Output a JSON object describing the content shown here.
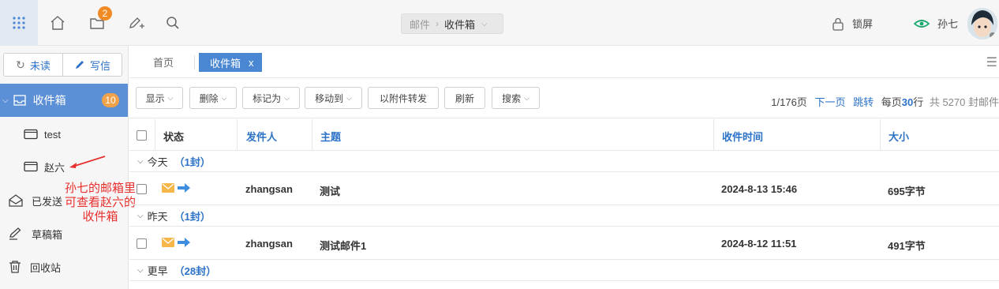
{
  "topbar": {
    "compose_badge": "2",
    "breadcrumb": {
      "root": "邮件",
      "current": "收件箱"
    },
    "lock_label": "锁屏",
    "user_name": "孙七",
    "colors": {
      "accent": "#4a87d2",
      "badge": "#f08a24",
      "user_icon": "#1aa86b"
    }
  },
  "sidebar": {
    "unread_label": "未读",
    "compose_label": "写信",
    "inbox": {
      "label": "收件箱",
      "count": "10"
    },
    "subfolders": [
      {
        "label": "test"
      },
      {
        "label": "赵六"
      }
    ],
    "sent_label": "已发送",
    "drafts_label": "草稿箱",
    "trash_label": "回收站"
  },
  "annotation": {
    "lines": [
      "孙七的邮箱里",
      "可查看赵六的",
      "收件箱"
    ],
    "color": "#e8302e"
  },
  "tabs": {
    "home": "首页",
    "active": "收件箱",
    "close": "x"
  },
  "toolbar": {
    "show": "显示",
    "delete": "删除",
    "mark_as": "标记为",
    "move_to": "移动到",
    "forward_attach": "以附件转发",
    "refresh": "刷新",
    "search": "搜索"
  },
  "pager": {
    "page_info": "1/176页",
    "next": "下一页",
    "jump": "跳转",
    "per_page_prefix": "每页",
    "per_page": "30",
    "per_page_suffix": "行",
    "total": "共 5270 封邮件"
  },
  "table": {
    "headers": {
      "status": "状态",
      "sender": "发件人",
      "subject": "主题",
      "time": "收件时间",
      "size": "大小"
    },
    "groups": [
      {
        "label": "今天",
        "count": "（1封）"
      },
      {
        "label": "昨天",
        "count": "（1封）"
      },
      {
        "label": "更早",
        "count": "（28封）"
      }
    ],
    "rows": [
      {
        "sender": "zhangsan",
        "subject": "测试",
        "time": "2024-8-13 15:46",
        "size": "695字节"
      },
      {
        "sender": "zhangsan",
        "subject": "测试邮件1",
        "time": "2024-8-12 11:51",
        "size": "491字节"
      }
    ]
  }
}
